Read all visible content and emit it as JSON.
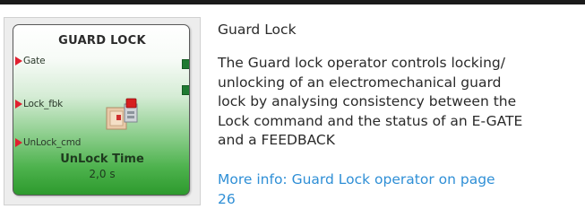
{
  "block": {
    "title": "GUARD LOCK",
    "inputs": [
      "Gate",
      "Lock_fbk",
      "UnLock_cmd"
    ],
    "param_name": "UnLock Time",
    "param_value": "2,0 s"
  },
  "description": {
    "title": "Guard Lock",
    "body_lines": [
      "The Guard lock operator controls locking/",
      "unlocking of an electromechanical guard",
      "lock by analysing consistency between the",
      "Lock command and the status of an E-GATE",
      "and a FEEDBACK"
    ],
    "link_lines": [
      "More info: Guard Lock operator on page",
      "26"
    ]
  },
  "colors": {
    "link": "#2f8fd6",
    "input_arrow": "#e02030",
    "output_port": "#1f7a32"
  }
}
